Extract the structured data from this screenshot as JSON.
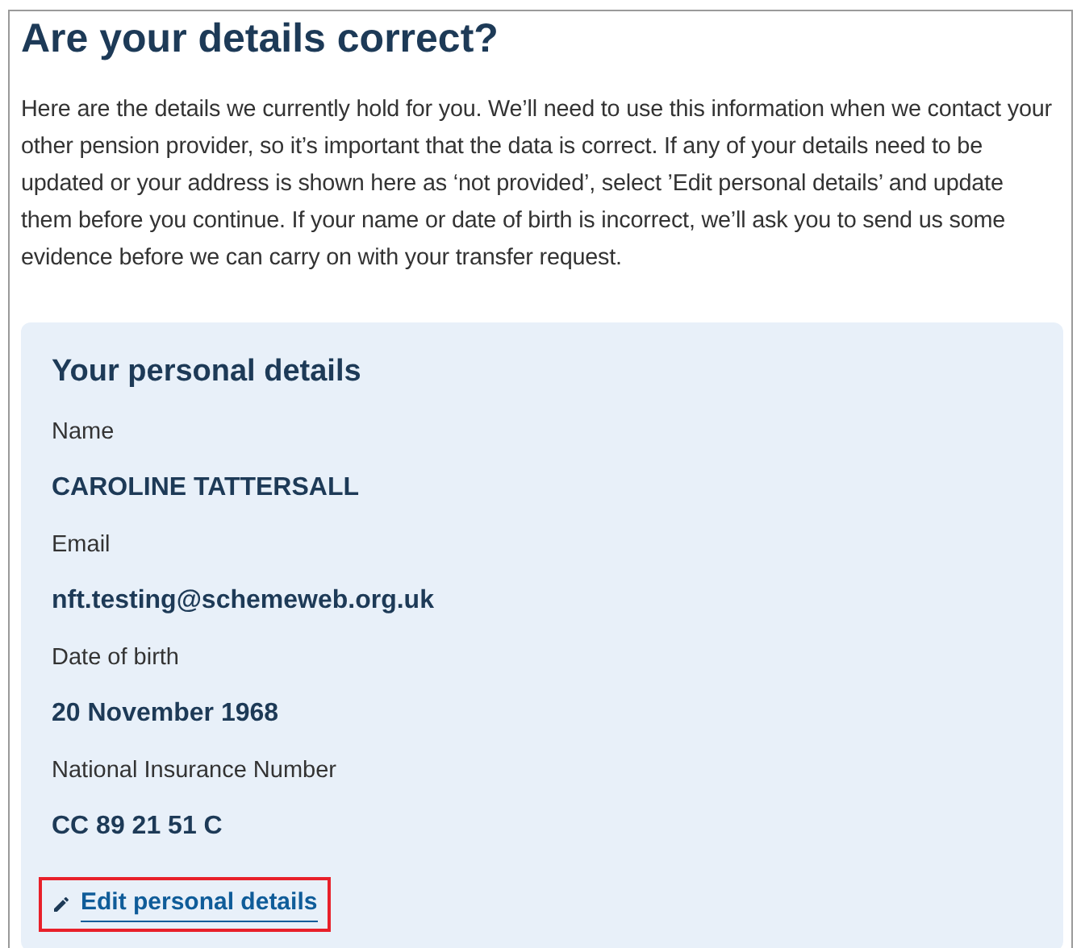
{
  "heading": "Are your details correct?",
  "intro": "Here are the details we currently hold for you. We’ll need to use this information when we contact your other pension provider, so it’s important that the data is correct. If any of your details need to be updated or your address is shown here as ‘not provided’, select ’Edit personal details’ and update them before you continue. If your name or date of birth is incorrect, we’ll ask you to send us some evidence before we can carry on with your transfer request.",
  "card": {
    "title": "Your personal details",
    "fields": [
      {
        "label": "Name",
        "value": "CAROLINE TATTERSALL"
      },
      {
        "label": "Email",
        "value": "nft.testing@schemeweb.org.uk"
      },
      {
        "label": "Date of birth",
        "value": "20 November 1968"
      },
      {
        "label": "National Insurance Number",
        "value": "CC 89 21 51 C"
      }
    ],
    "edit_link": {
      "label": "Edit personal details",
      "highlighted": true
    }
  }
}
